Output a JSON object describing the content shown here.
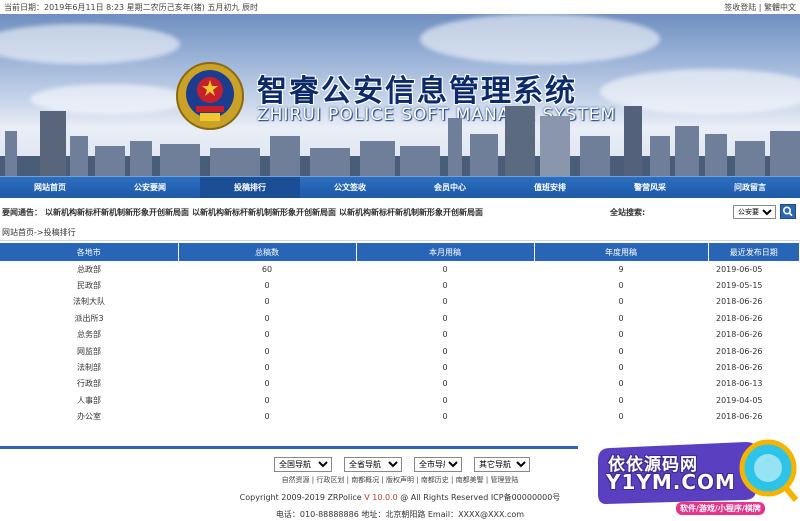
{
  "topbar": {
    "date_text": "当前日期：2019年6月11日 8:23 星期二农历己亥年(猪) 五月初九 辰时",
    "links": [
      "签收登陆",
      "繁體中文"
    ]
  },
  "banner": {
    "title_cn": "智睿公安信息管理系统",
    "title_en": "ZHIRUI POLICE SOFT MANAGE SYSTEM"
  },
  "nav": {
    "items": [
      "网站首页",
      "公安要闻",
      "投稿排行",
      "公文签收",
      "会员中心",
      "值班安排",
      "警营风采",
      "问政留言"
    ]
  },
  "notice": {
    "label": "要闻通告：",
    "items": [
      "以新机构新标杆新机制新形象开创新局面",
      "以新机构新标杆新机制新形象开创新局面",
      "以新机构新标杆新机制新形象开创新局面"
    ],
    "search_label": "全站搜索:",
    "search_select": "公安要闻"
  },
  "breadcrumb": "网站首页->投稿排行",
  "table": {
    "headers": [
      "各地市",
      "总稿数",
      "本月用稿",
      "年度用稿",
      "最近发布日期"
    ],
    "rows": [
      [
        "总政部",
        "60",
        "0",
        "9",
        "2019-06-05"
      ],
      [
        "民政部",
        "0",
        "0",
        "0",
        "2019-05-15"
      ],
      [
        "法制大队",
        "0",
        "0",
        "0",
        "2018-06-26"
      ],
      [
        "派出所3",
        "0",
        "0",
        "0",
        "2018-06-26"
      ],
      [
        "总务部",
        "0",
        "0",
        "0",
        "2018-06-26"
      ],
      [
        "网监部",
        "0",
        "0",
        "0",
        "2018-06-26"
      ],
      [
        "法制部",
        "0",
        "0",
        "0",
        "2018-06-26"
      ],
      [
        "行政部",
        "0",
        "0",
        "0",
        "2018-06-13"
      ],
      [
        "人事部",
        "0",
        "0",
        "0",
        "2019-04-05"
      ],
      [
        "办公室",
        "0",
        "0",
        "0",
        "2018-06-26"
      ]
    ]
  },
  "footer": {
    "selects": [
      "全国导航",
      "全省导航",
      "全市导航",
      "其它导航"
    ],
    "links": [
      "自然资源",
      "行政区划",
      "南都概况",
      "版权声明",
      "南都历史",
      "南都美警",
      "管理登陆"
    ],
    "copyright_pre": "Copyright 2009-2019 ZRPolice",
    "copyright_ver": "V 10.0.0",
    "copyright_post": "@ All Rights Reserved ICP备00000000号",
    "contact": "电话：010-88888886    地址：北京朝阳路 Email：XXXX@XXX.com"
  },
  "watermark": {
    "line1": "依依源码网",
    "line2": "Y1YM.COM",
    "line3": "软件/游戏/小程序/棋牌"
  },
  "colors": {
    "nav_bg": "#2d6fc0",
    "table_header": "#2865b6",
    "accent": "#c0392b"
  }
}
